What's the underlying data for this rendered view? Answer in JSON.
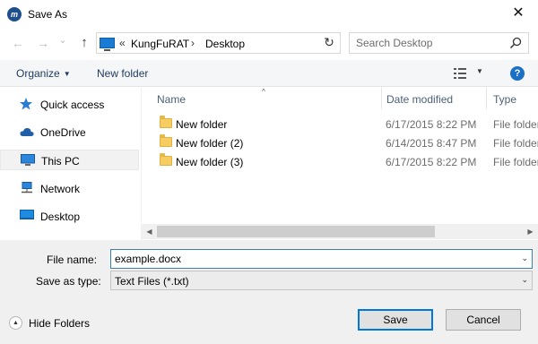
{
  "window": {
    "title": "Save As",
    "app_icon": "m",
    "close_glyph": "✕"
  },
  "nav": {
    "back_glyph": "←",
    "forward_glyph": "→",
    "history_glyph": "⌄",
    "up_glyph": "↑",
    "breadcrumb_overflow": "«",
    "breadcrumbs": [
      "KungFuRAT",
      "Desktop"
    ],
    "breadcrumb_separator": "›",
    "dropdown_glyph": "⌄",
    "refresh_glyph": "↻",
    "search_placeholder": "Search Desktop"
  },
  "toolbar": {
    "organize_label": "Organize",
    "organize_arrow": "▼",
    "new_folder_label": "New folder",
    "view_arrow": "▼",
    "help_glyph": "?"
  },
  "sidebar": {
    "items": [
      {
        "label": "Quick access",
        "icon": "star-icon"
      },
      {
        "label": "OneDrive",
        "icon": "cloud-icon"
      },
      {
        "label": "This PC",
        "icon": "computer-icon",
        "selected": true
      },
      {
        "label": "Network",
        "icon": "network-icon"
      },
      {
        "label": "Desktop",
        "icon": "desktop-icon"
      }
    ]
  },
  "files": {
    "sort_glyph": "^",
    "columns": {
      "name": "Name",
      "date": "Date modified",
      "type": "Type"
    },
    "rows": [
      {
        "name": "New folder",
        "date": "6/17/2015 8:22 PM",
        "type": "File folder"
      },
      {
        "name": "New folder (2)",
        "date": "6/14/2015 8:47 PM",
        "type": "File folder"
      },
      {
        "name": "New folder (3)",
        "date": "6/17/2015 8:22 PM",
        "type": "File folder"
      }
    ]
  },
  "scrollbar": {
    "left_glyph": "◀",
    "right_glyph": "▶"
  },
  "form": {
    "file_name_label": "File name:",
    "file_name_value": "example.docx",
    "save_type_label": "Save as type:",
    "save_type_value": "Text Files (*.txt)",
    "dropdown_glyph": "⌄"
  },
  "footer": {
    "hide_folders_label": "Hide Folders",
    "hide_folders_glyph": "▲",
    "save_label": "Save",
    "cancel_label": "Cancel"
  },
  "colors": {
    "accent": "#0078d7",
    "toolbar_bg": "#f5f6f7",
    "footer_bg": "#f0f0f0",
    "folder": "#f6cd60"
  }
}
